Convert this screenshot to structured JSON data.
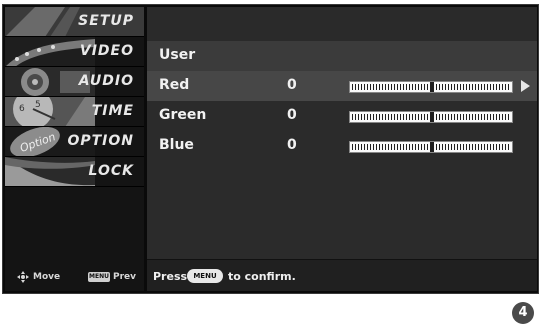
{
  "sidebar": {
    "items": [
      {
        "label": "SETUP"
      },
      {
        "label": "VIDEO"
      },
      {
        "label": "AUDIO"
      },
      {
        "label": "TIME"
      },
      {
        "label": "OPTION"
      },
      {
        "label": "LOCK"
      }
    ],
    "footer": {
      "move_label": "Move",
      "menu_badge": "MENU",
      "prev_label": "Prev"
    }
  },
  "panel": {
    "title": "User",
    "rows": [
      {
        "name": "Red",
        "value": "0",
        "level": 0.5
      },
      {
        "name": "Green",
        "value": "0",
        "level": 0.5
      },
      {
        "name": "Blue",
        "value": "0",
        "level": 0.5
      }
    ],
    "footer": {
      "press": "Press",
      "menu_badge": "MENU",
      "confirm": "to confirm."
    }
  },
  "page_number": "4",
  "colors": {
    "background": "#0a0a0a",
    "selected_row": "#474747",
    "slider_bg": "#fafafa"
  }
}
